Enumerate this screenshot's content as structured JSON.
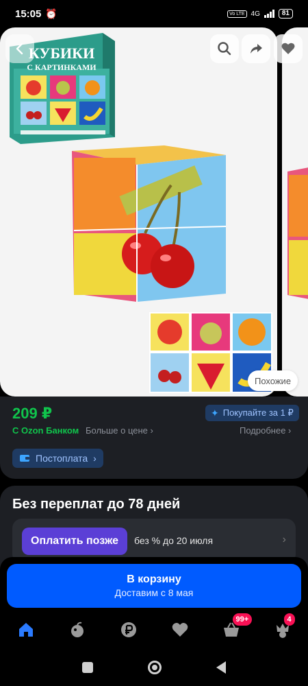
{
  "status_bar": {
    "time": "15:05",
    "network": "4G",
    "volte": "Vo LTE",
    "battery": "81"
  },
  "product_box": {
    "title_line1": "КУБИКИ",
    "title_line2": "С КАРТИНКАМИ"
  },
  "gallery": {
    "similar_label": "Похожие"
  },
  "price_block": {
    "price": "209 ₽",
    "promo": "Покупайте за 1 ₽",
    "bank_label": "С Ozon Банком",
    "more_price": "Больше о цене",
    "details": "Подробнее",
    "postpay": "Постоплата"
  },
  "installment": {
    "title": "Без переплат до 78 дней",
    "button": "Оплатить позже",
    "text": "без % до 20 июля"
  },
  "cart": {
    "title": "В корзину",
    "delivery": "Доставим с 8 мая"
  },
  "bottom_nav": {
    "items": [
      {
        "icon": "home-icon"
      },
      {
        "icon": "fresh-icon"
      },
      {
        "icon": "ruble-icon"
      },
      {
        "icon": "heart-icon"
      },
      {
        "icon": "basket-icon",
        "badge": "99+"
      },
      {
        "icon": "profile-icon",
        "badge": "4"
      }
    ]
  },
  "colors": {
    "accent": "#005bff",
    "price_green": "#10c44c",
    "badge_pink": "#f91155",
    "pay_later": "#5b3fd6"
  }
}
